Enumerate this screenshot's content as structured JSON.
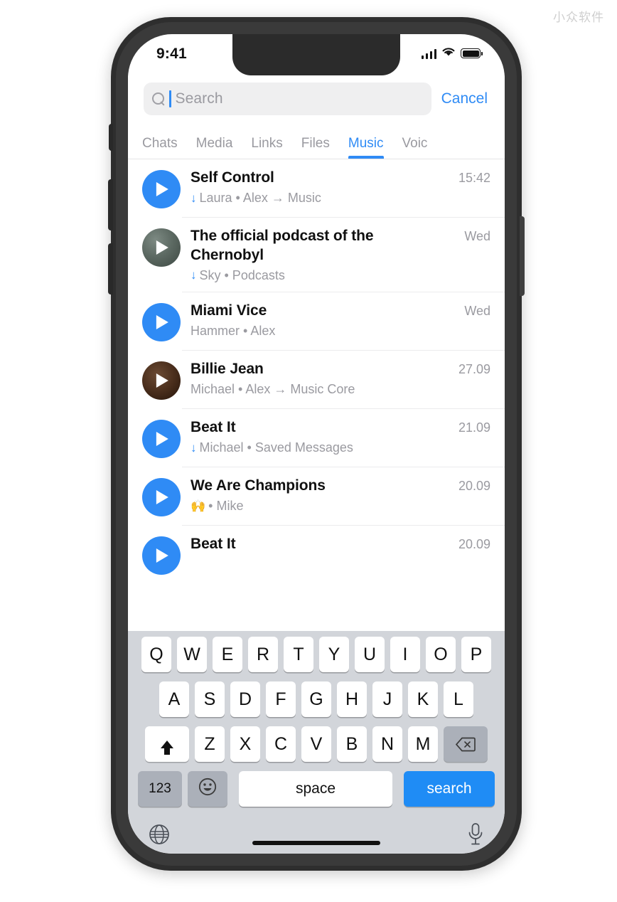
{
  "watermark": "小众软件",
  "status_bar": {
    "time": "9:41",
    "signal_icon": "signal-bars-icon",
    "wifi_icon": "wifi-icon",
    "battery_icon": "battery-full-icon"
  },
  "search": {
    "placeholder": "Search",
    "value": "",
    "cancel_label": "Cancel",
    "icon": "search-icon",
    "accent_color": "#2f8bf5"
  },
  "tabs": [
    {
      "label": "Chats",
      "active": false
    },
    {
      "label": "Media",
      "active": false
    },
    {
      "label": "Links",
      "active": false
    },
    {
      "label": "Files",
      "active": false
    },
    {
      "label": "Music",
      "active": true
    },
    {
      "label": "Voic",
      "active": false
    }
  ],
  "music_list": [
    {
      "title": "Self Control",
      "downloaded": true,
      "emoji": "",
      "subtitle": "Laura • Alex → Music",
      "time": "15:42",
      "thumb": "play-blue"
    },
    {
      "title": "The official podcast of the Chernobyl",
      "downloaded": true,
      "emoji": "",
      "subtitle": "Sky • Podcasts",
      "time": "Wed",
      "thumb": "image-chernobyl"
    },
    {
      "title": "Miami Vice",
      "downloaded": false,
      "emoji": "",
      "subtitle": "Hammer • Alex",
      "time": "Wed",
      "thumb": "play-blue"
    },
    {
      "title": "Billie Jean",
      "downloaded": false,
      "emoji": "",
      "subtitle": "Michael • Alex → Music Core",
      "time": "27.09",
      "thumb": "image-billie"
    },
    {
      "title": "Beat It",
      "downloaded": true,
      "emoji": "",
      "subtitle": "Michael • Saved Messages",
      "time": "21.09",
      "thumb": "play-blue"
    },
    {
      "title": "We Are Champions",
      "downloaded": false,
      "emoji": "🙌",
      "subtitle": "• Mike",
      "time": "20.09",
      "thumb": "play-blue"
    },
    {
      "title": "Beat It",
      "downloaded": false,
      "emoji": "",
      "subtitle": "",
      "time": "20.09",
      "thumb": "play-blue"
    }
  ],
  "keyboard": {
    "row1": [
      "Q",
      "W",
      "E",
      "R",
      "T",
      "Y",
      "U",
      "I",
      "O",
      "P"
    ],
    "row2": [
      "A",
      "S",
      "D",
      "F",
      "G",
      "H",
      "J",
      "K",
      "L"
    ],
    "row3": [
      "Z",
      "X",
      "C",
      "V",
      "B",
      "N",
      "M"
    ],
    "shift_icon": "shift-icon",
    "backspace_icon": "backspace-icon",
    "numbers_label": "123",
    "emoji_icon": "emoji-icon",
    "space_label": "space",
    "search_label": "search",
    "globe_icon": "globe-icon",
    "mic_icon": "microphone-icon",
    "return_key_color": "#1f8cf5"
  }
}
